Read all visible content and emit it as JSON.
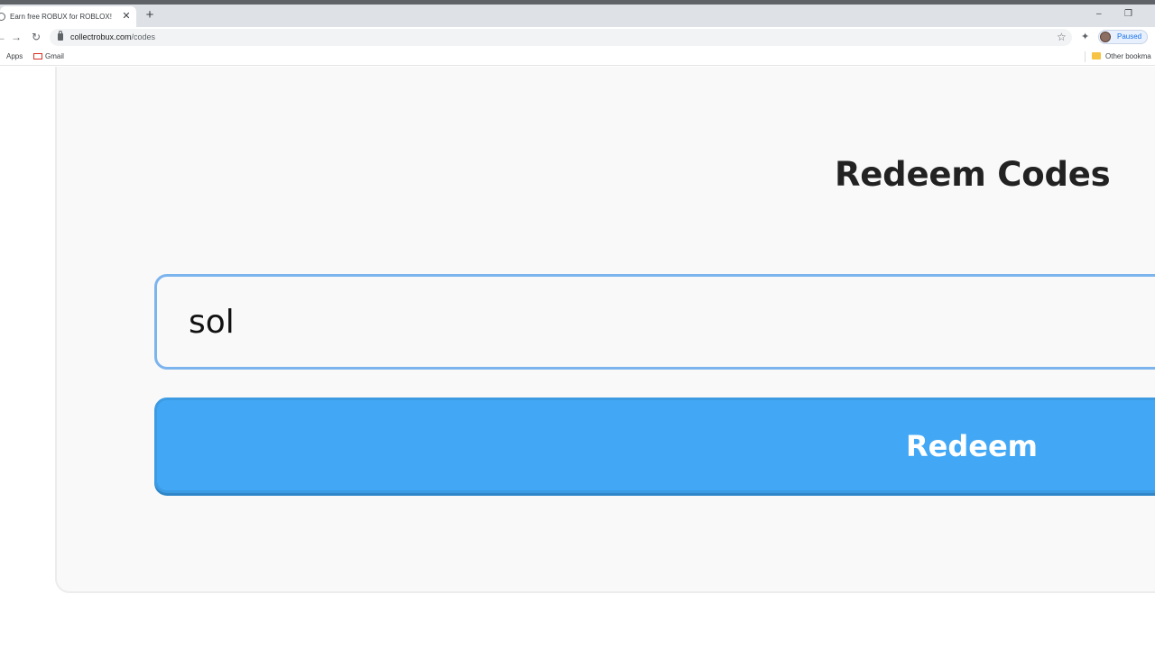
{
  "browser": {
    "tab": {
      "title": "Earn free ROBUX for ROBLOX!",
      "close_glyph": "✕"
    },
    "new_tab_glyph": "+",
    "window_controls": {
      "minimize": "–",
      "restore": "❐"
    },
    "nav": {
      "back": "←",
      "forward": "→",
      "reload": "↻"
    },
    "address": {
      "host": "collectrobux.com",
      "path": "/codes"
    },
    "bookmark_star": "☆",
    "extensions_glyph": "✦",
    "profile": {
      "label": "Paused"
    },
    "bookmarks": {
      "apps": "Apps",
      "gmail": "Gmail",
      "other": "Other bookma"
    }
  },
  "page": {
    "heading": "Redeem Codes",
    "code_input": {
      "value": "sol"
    },
    "redeem_button": {
      "label": "Redeem"
    },
    "colors": {
      "button_bg": "#42a8f5",
      "input_border": "#7cb4ee",
      "card_bg": "#f9f9f9"
    }
  }
}
